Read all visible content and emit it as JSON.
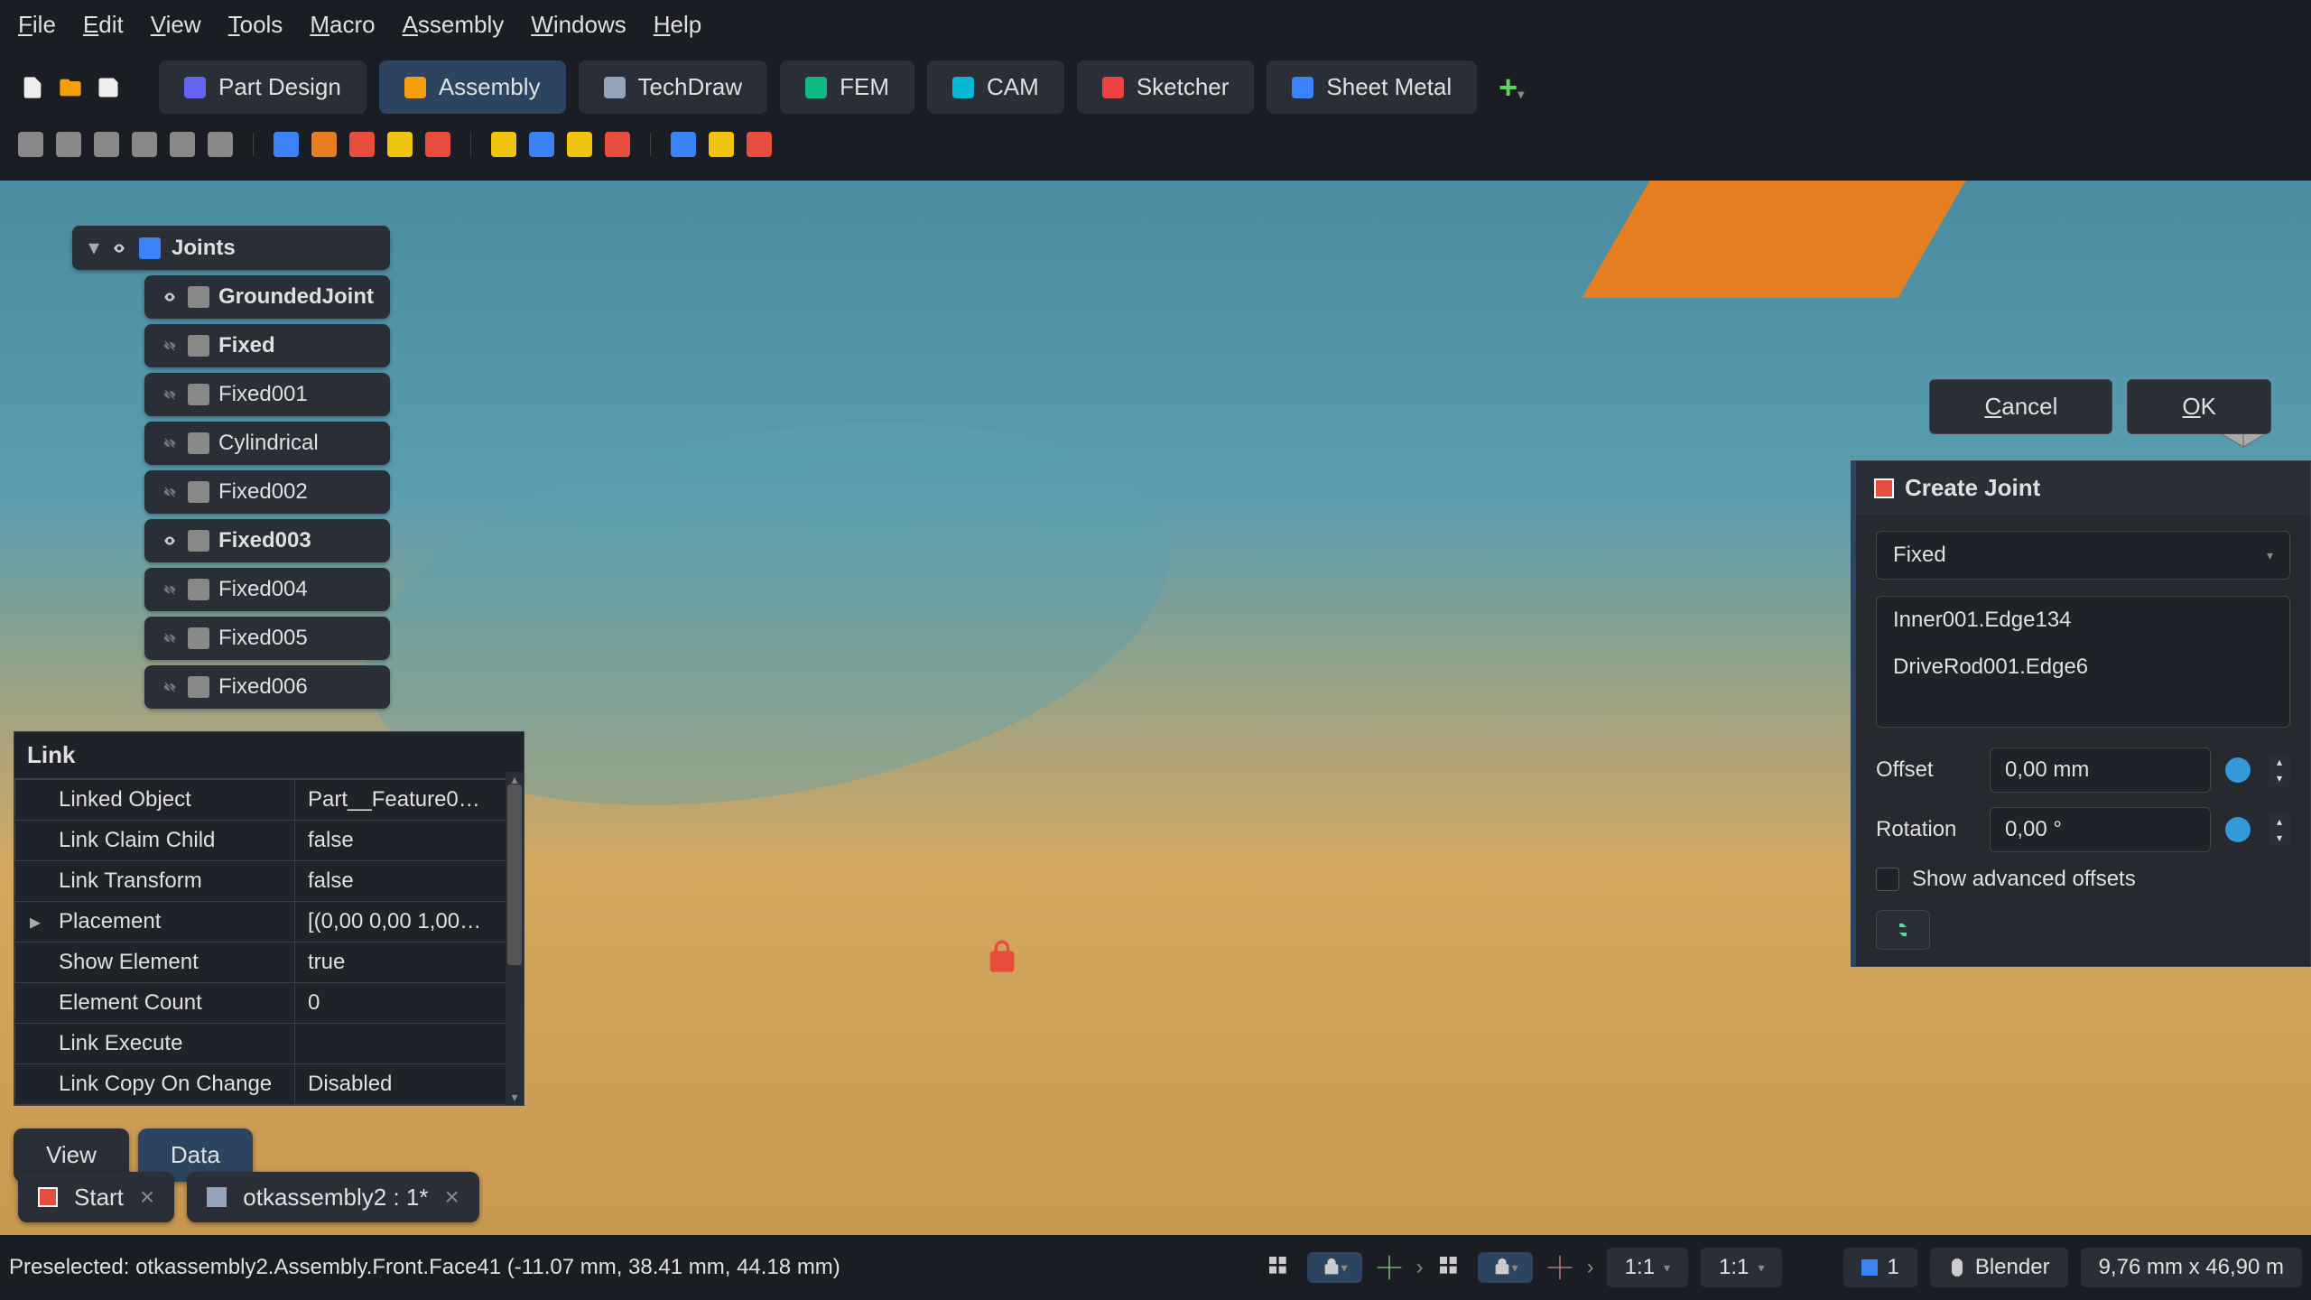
{
  "menubar": [
    "File",
    "Edit",
    "View",
    "Tools",
    "Macro",
    "Assembly",
    "Windows",
    "Help"
  ],
  "workbenches": [
    {
      "label": "Part Design",
      "active": false,
      "color": "#6366f1"
    },
    {
      "label": "Assembly",
      "active": true,
      "color": "#f59e0b"
    },
    {
      "label": "TechDraw",
      "active": false,
      "color": "#94a3b8"
    },
    {
      "label": "FEM",
      "active": false,
      "color": "#10b981"
    },
    {
      "label": "CAM",
      "active": false,
      "color": "#06b6d4"
    },
    {
      "label": "Sketcher",
      "active": false,
      "color": "#ef4444"
    },
    {
      "label": "Sheet Metal",
      "active": false,
      "color": "#3b82f6"
    }
  ],
  "tree": {
    "group_label": "Joints",
    "items": [
      {
        "label": "GroundedJoint",
        "bold": true,
        "vis": true
      },
      {
        "label": "Fixed",
        "bold": true,
        "vis": false
      },
      {
        "label": "Fixed001",
        "bold": false,
        "vis": false
      },
      {
        "label": "Cylindrical",
        "bold": false,
        "vis": false
      },
      {
        "label": "Fixed002",
        "bold": false,
        "vis": false
      },
      {
        "label": "Fixed003",
        "bold": true,
        "vis": true
      },
      {
        "label": "Fixed004",
        "bold": false,
        "vis": false
      },
      {
        "label": "Fixed005",
        "bold": false,
        "vis": false
      },
      {
        "label": "Fixed006",
        "bold": false,
        "vis": false
      }
    ]
  },
  "property": {
    "header": "Link",
    "rows": [
      {
        "name": "Linked Object",
        "value": "Part__Feature0…"
      },
      {
        "name": "Link Claim Child",
        "value": "false"
      },
      {
        "name": "Link Transform",
        "value": "false"
      },
      {
        "name": "Placement",
        "value": "[(0,00 0,00 1,00…",
        "expandable": true
      },
      {
        "name": "Show Element",
        "value": "true"
      },
      {
        "name": "Element Count",
        "value": "0"
      },
      {
        "name": "Link Execute",
        "value": ""
      },
      {
        "name": "Link Copy On Change",
        "value": "Disabled"
      }
    ],
    "tabs": {
      "view": "View",
      "data": "Data"
    }
  },
  "documents": [
    {
      "label": "Start"
    },
    {
      "label": "otkassembly2 : 1*"
    }
  ],
  "task": {
    "cancel": "Cancel",
    "ok": "OK",
    "title": "Create Joint",
    "joint_type": "Fixed",
    "ref1": "Inner001.Edge134",
    "ref2": "DriveRod001.Edge6",
    "offset_label": "Offset",
    "offset_value": "0,00 mm",
    "rotation_label": "Rotation",
    "rotation_value": "0,00 °",
    "advanced_label": "Show advanced offsets"
  },
  "status": {
    "text": "Preselected: otkassembly2.Assembly.Front.Face41 (-11.07 mm, 38.41 mm, 44.18 mm)",
    "ratio1": "1:1",
    "ratio2": "1:1",
    "num": "1",
    "nav": "Blender",
    "dims": "9,76 mm x 46,90 m"
  }
}
